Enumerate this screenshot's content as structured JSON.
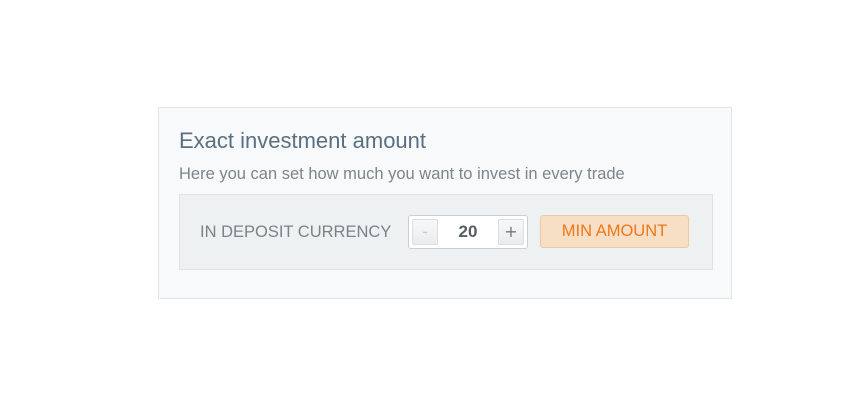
{
  "card": {
    "title": "Exact investment amount",
    "subtitle": "Here you can set how much you want to invest in every trade"
  },
  "panel": {
    "label": "IN DEPOSIT CURRENCY",
    "stepper": {
      "minus_label": "-",
      "plus_label": "+",
      "value": "20"
    },
    "min_button_label": "MIN AMOUNT"
  },
  "colors": {
    "accent": "#f0761c",
    "accent_bg": "#f6dfc5",
    "title": "#5a6f80"
  },
  "icons": {
    "minus": "minus-icon",
    "plus": "plus-icon"
  }
}
